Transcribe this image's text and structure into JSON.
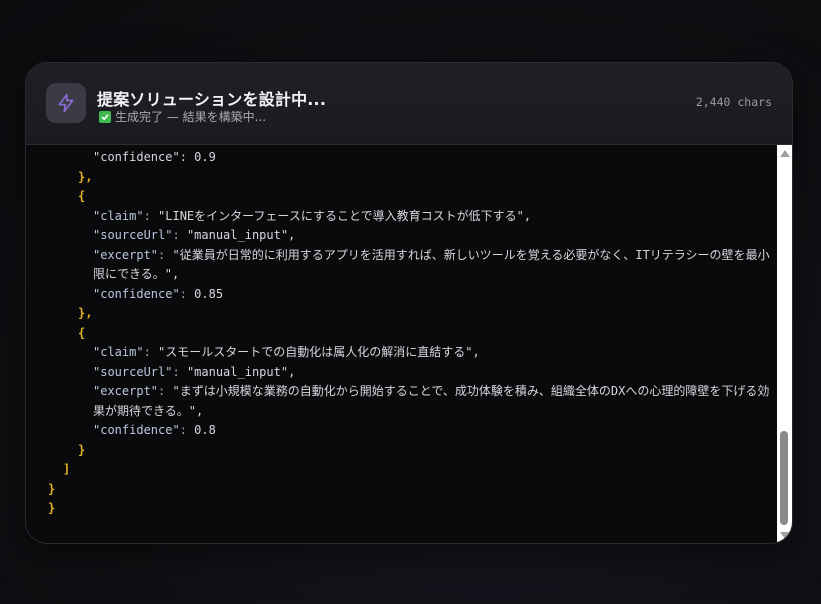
{
  "header": {
    "title": "提案ソリューションを設計中...",
    "status": "生成完了 — 結果を構築中...",
    "chars": "2,440 chars",
    "icon": "lightning-icon",
    "accent": "#8b6bd6"
  },
  "code": {
    "l01": "\"confidence\": 0.9",
    "l02": "},",
    "l03": "{",
    "l04k": "\"claim\"",
    "l04v": "\"LINEをインターフェースにすることで導入教育コストが低下する\",",
    "l05k": "\"sourceUrl\"",
    "l05v": "\"manual_input\",",
    "l06k": "\"excerpt\"",
    "l06v": "\"従業員が日常的に利用するアプリを活用すれば、新しいツールを覚える必要がなく、ITリテラシーの壁を最小限にできる。\",",
    "l07k": "\"confidence\"",
    "l07v": "0.85",
    "l08": "},",
    "l09": "{",
    "l10k": "\"claim\"",
    "l10v": "\"スモールスタートでの自動化は属人化の解消に直結する\",",
    "l11k": "\"sourceUrl\"",
    "l11v": "\"manual_input\",",
    "l12k": "\"excerpt\"",
    "l12v": "\"まずは小規模な業務の自動化から開始することで、成功体験を積み、組織全体のDXへの心理的障壁を下げる効果が期待できる。\",",
    "l13k": "\"confidence\"",
    "l13v": "0.8",
    "l14": "}",
    "l15": "]",
    "l16": "}",
    "l17": "}"
  }
}
